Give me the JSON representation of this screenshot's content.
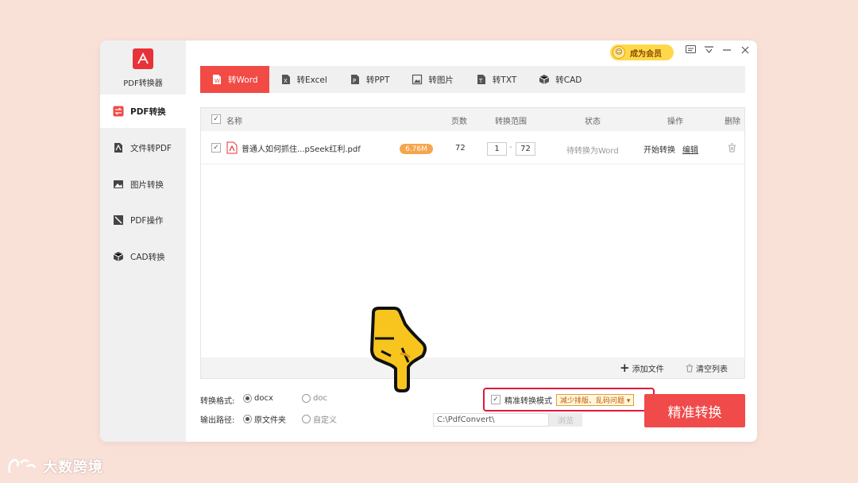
{
  "app": {
    "name": "PDF转换器",
    "vip_label": "成为会员"
  },
  "sidebar": {
    "items": [
      {
        "label": "PDF转换",
        "icon": "swap-icon",
        "active": true
      },
      {
        "label": "文件转PDF",
        "icon": "pdf-file-icon",
        "active": false
      },
      {
        "label": "图片转换",
        "icon": "image-icon",
        "active": false
      },
      {
        "label": "PDF操作",
        "icon": "pdf-edit-icon",
        "active": false
      },
      {
        "label": "CAD转换",
        "icon": "cube-icon",
        "active": false
      }
    ]
  },
  "tabs": [
    {
      "label": "转Word",
      "icon": "word-icon",
      "active": true
    },
    {
      "label": "转Excel",
      "icon": "excel-icon",
      "active": false
    },
    {
      "label": "转PPT",
      "icon": "ppt-icon",
      "active": false
    },
    {
      "label": "转图片",
      "icon": "picture-icon",
      "active": false
    },
    {
      "label": "转TXT",
      "icon": "txt-icon",
      "active": false
    },
    {
      "label": "转CAD",
      "icon": "cad-icon",
      "active": false
    }
  ],
  "table": {
    "headers": {
      "name": "名称",
      "pages": "页数",
      "range": "转换范围",
      "status": "状态",
      "action": "操作",
      "delete": "删除"
    },
    "rows": [
      {
        "checked": true,
        "file_name": "普通人如何抓住...pSeek红利.pdf",
        "size": "6.76M",
        "pages": "72",
        "range_from": "1",
        "range_to": "72",
        "status": "待转换为Word",
        "start_label": "开始转换",
        "edit_label": "编辑"
      }
    ]
  },
  "footer": {
    "add_file": "添加文件",
    "clear_list": "清空列表"
  },
  "options": {
    "format_label": "转换格式:",
    "format_docx": "docx",
    "format_doc": "doc",
    "selected_format": "docx",
    "output_label": "输出路径:",
    "output_original": "原文件夹",
    "output_custom": "自定义",
    "path_value": "C:\\PdfConvert\\",
    "browse_label": "浏览",
    "precise_mode_label": "精准转换模式",
    "precise_mode_checked": true,
    "precise_mode_option": "减少排版、乱码问题 ▾"
  },
  "convert_button": "精准转换",
  "watermark": "大数跨境",
  "colors": {
    "accent": "#f24a45",
    "highlight_border": "#e0183a",
    "link": "#2b72d9",
    "background": "#f9e1d8"
  }
}
